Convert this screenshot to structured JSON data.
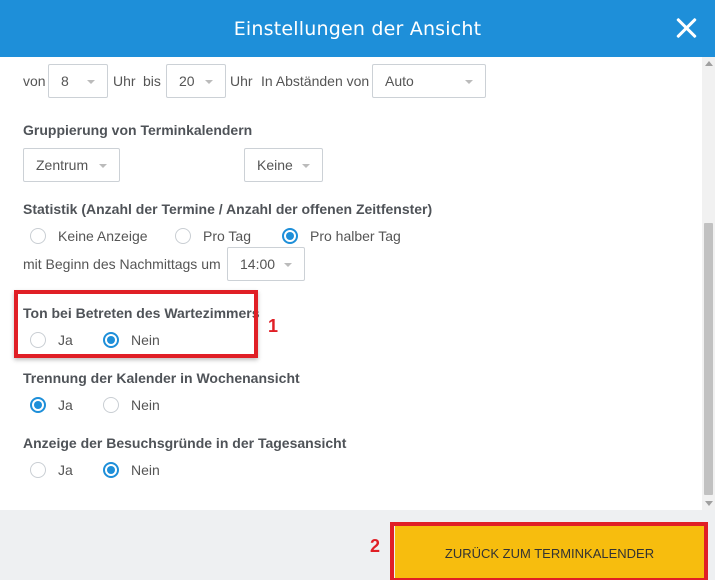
{
  "header": {
    "title": "Einstellungen der Ansicht"
  },
  "time_range": {
    "from_label": "von",
    "from_value": "8",
    "hour1": "Uhr",
    "to_label": "bis",
    "to_value": "20",
    "hour2": "Uhr",
    "interval_label": "In Abständen von",
    "interval_value": "Auto"
  },
  "grouping": {
    "title": "Gruppierung von Terminkalendern",
    "first_value": "Zentrum",
    "second_value": "Keine"
  },
  "statistics": {
    "title": "Statistik (Anzahl der Termine / Anzahl der offenen Zeitfenster)",
    "options": [
      "Keine Anzeige",
      "Pro Tag",
      "Pro halber Tag"
    ],
    "selected": 2,
    "afternoon_label": "mit Beginn des Nachmittags um",
    "afternoon_value": "14:00"
  },
  "waiting_room_sound": {
    "title": "Ton bei Betreten des Wartezimmers",
    "options": [
      "Ja",
      "Nein"
    ],
    "selected": 1
  },
  "week_view_separation": {
    "title": "Trennung der Kalender in Wochenansicht",
    "options": [
      "Ja",
      "Nein"
    ],
    "selected": 0
  },
  "day_view_reasons": {
    "title": "Anzeige der Besuchsgründe in der Tagesansicht",
    "options": [
      "Ja",
      "Nein"
    ],
    "selected": 1
  },
  "annotations": {
    "marker1": "1",
    "marker2": "2"
  },
  "footer": {
    "back_button": "ZURÜCK ZUM TERMINKALENDER"
  },
  "colors": {
    "header": "#1e8fd9",
    "button": "#f7bd0e",
    "highlight": "#e01f26"
  }
}
